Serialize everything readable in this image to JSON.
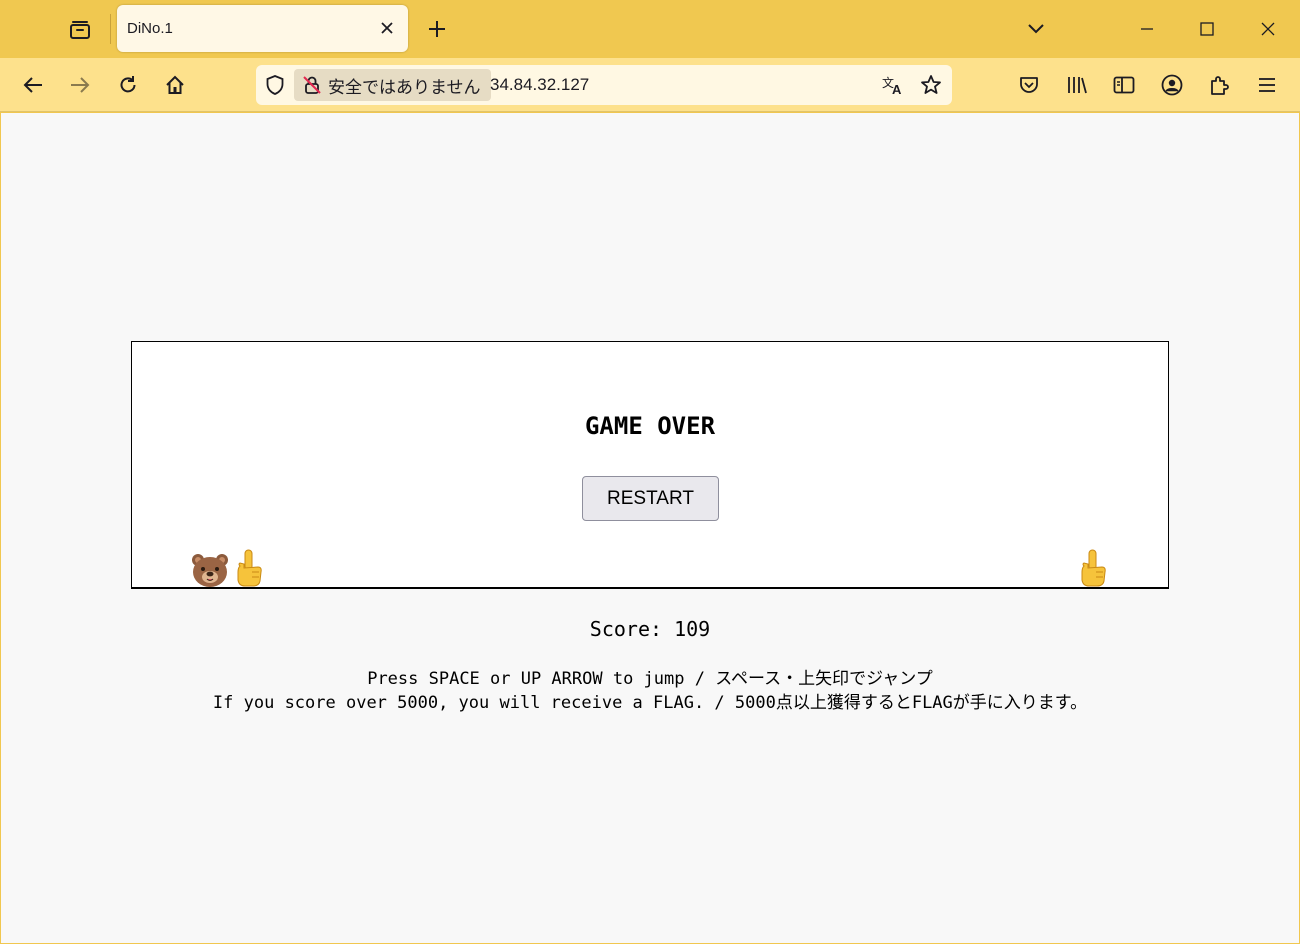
{
  "browser": {
    "tab_title": "DiNo.1",
    "url": "34.84.32.127",
    "security_label": "安全ではありません"
  },
  "game": {
    "status": "GAME OVER",
    "restart_label": "RESTART",
    "score_text": "Score: 109",
    "instruction_line1": "Press SPACE or UP ARROW to jump / スペース・上矢印でジャンプ",
    "instruction_line2": "If you score over 5000, you will receive a FLAG. / 5000点以上獲得するとFLAGが手に入ります。"
  },
  "icons": {
    "player": "bear-face-icon",
    "obstacle": "pointing-up-finger-icon"
  },
  "colors": {
    "tabstrip": "#f0c850",
    "toolbar": "#fde18c",
    "page_bg": "#f8f8f8",
    "game_bg": "#ffffff"
  }
}
